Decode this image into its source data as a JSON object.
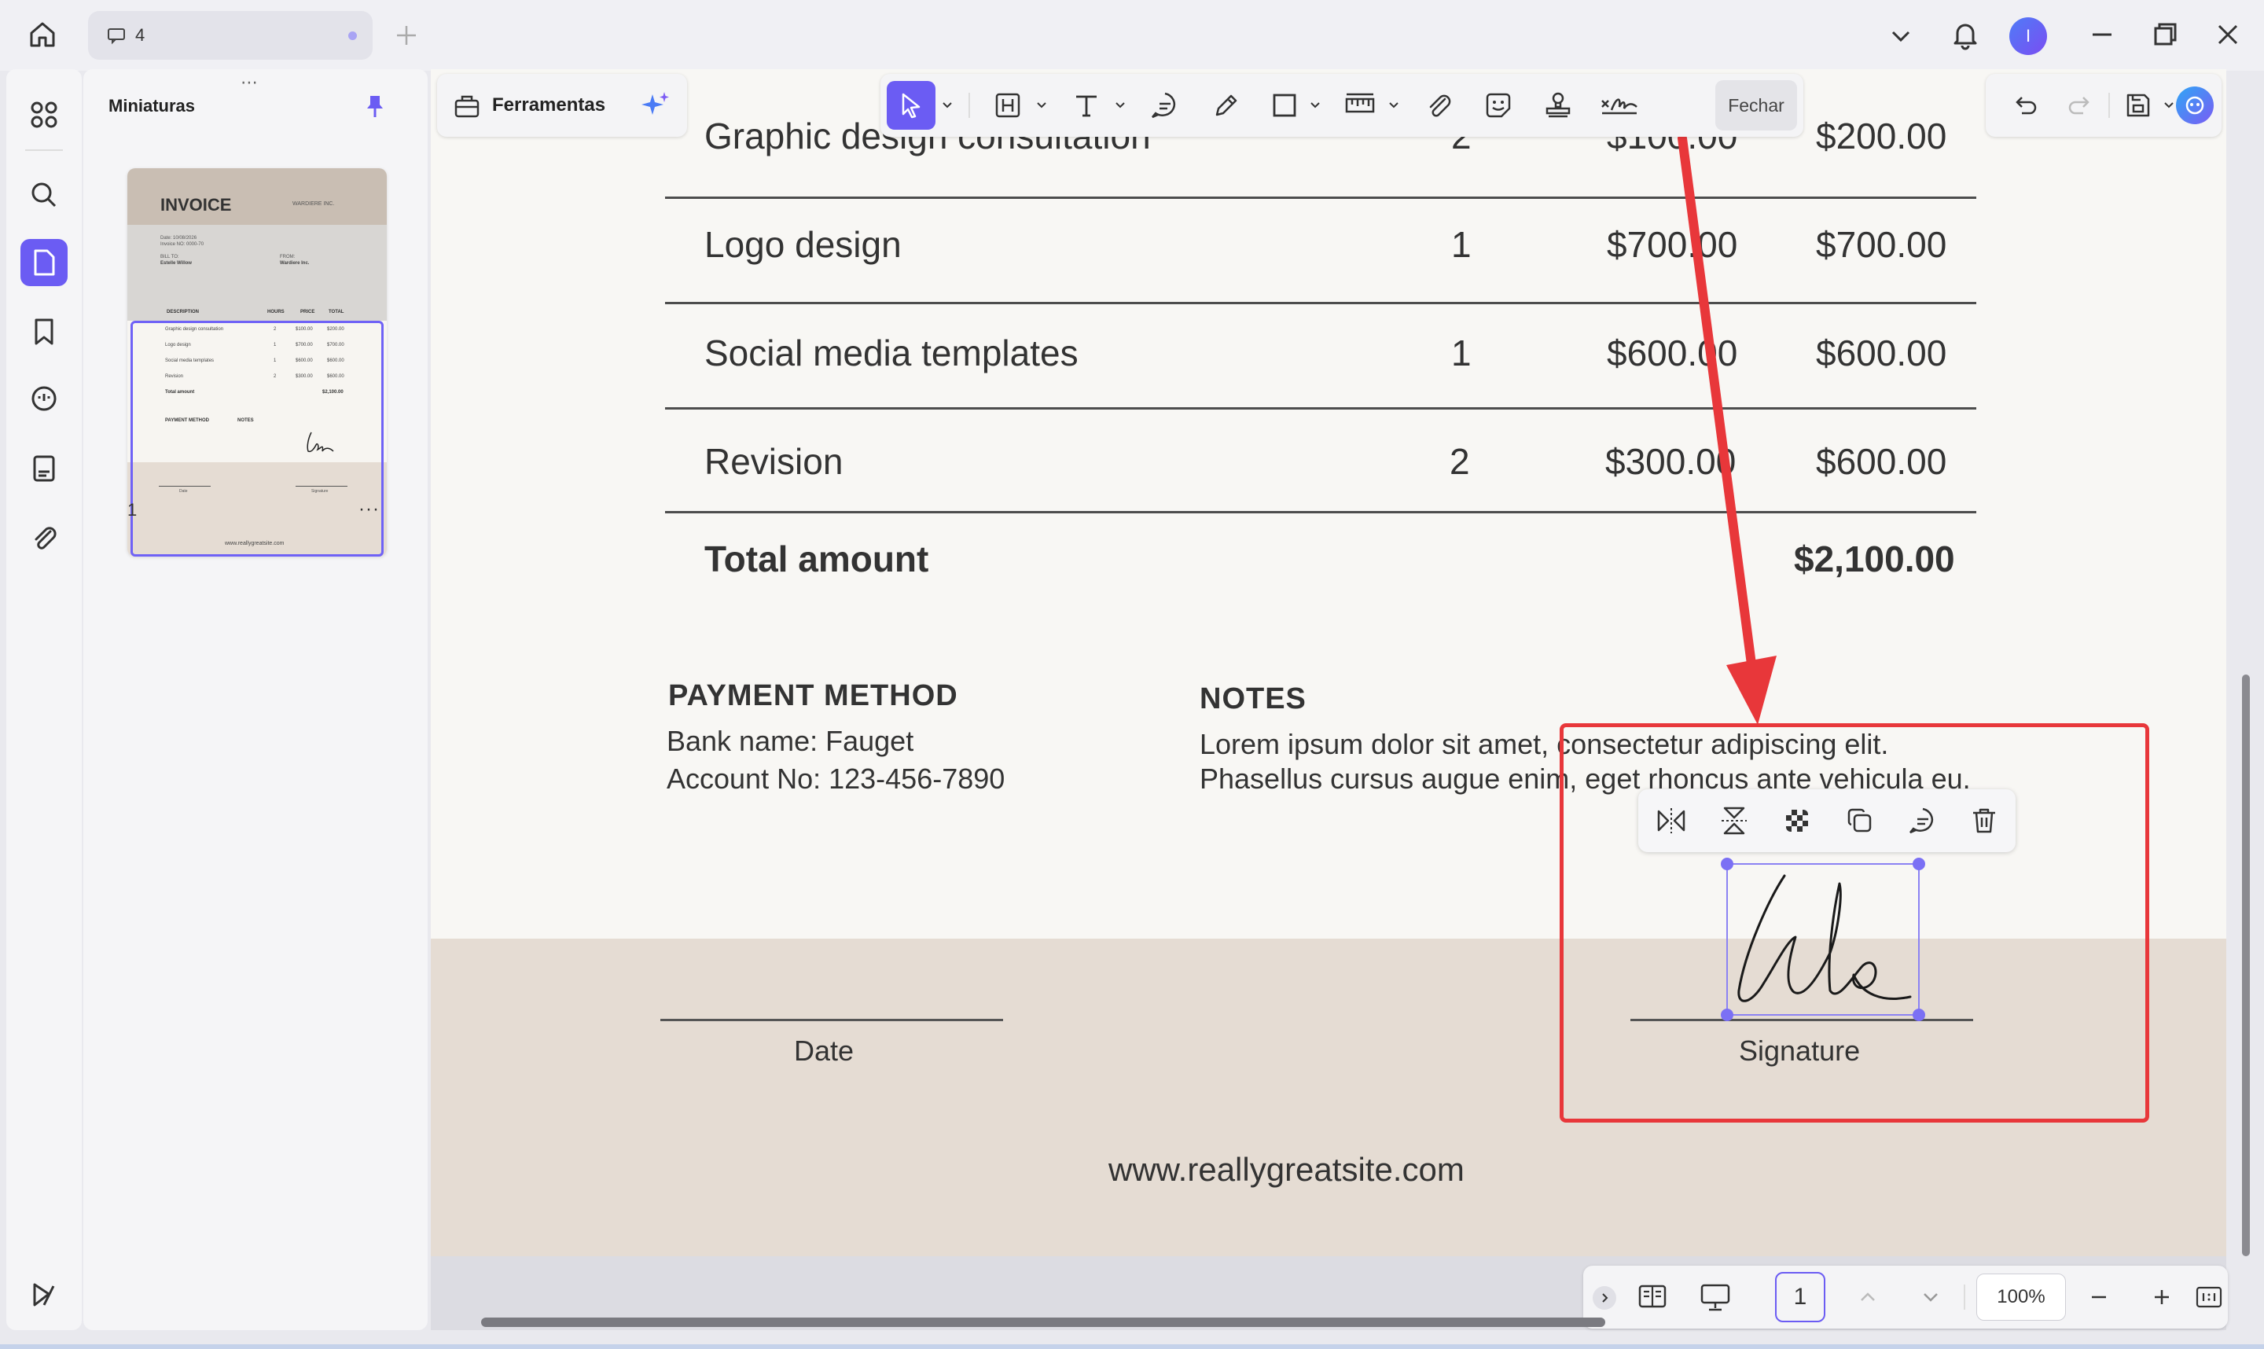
{
  "tab": {
    "label": "4"
  },
  "panel": {
    "title": "Miniaturas",
    "page_number": "1",
    "more": "···"
  },
  "thumbnail": {
    "title": "INVOICE",
    "company": "WARDIERE INC.",
    "date": "Date: 10/08/2026",
    "invoice_no": "Invoice NO: 0000-70",
    "bill_to": "BILL TO:",
    "bill_name": "Estelle Willow",
    "from": "FROM:",
    "from_name": "Wardiere Inc.",
    "columns": [
      "DESCRIPTION",
      "HOURS",
      "PRICE",
      "TOTAL"
    ],
    "rows": [
      [
        "Graphic design consultation",
        "2",
        "$100.00",
        "$200.00"
      ],
      [
        "Logo design",
        "1",
        "$700.00",
        "$700.00"
      ],
      [
        "Social media templates",
        "1",
        "$600.00",
        "$600.00"
      ],
      [
        "Revision",
        "2",
        "$300.00",
        "$600.00"
      ]
    ],
    "total_label": "Total amount",
    "total_value": "$2,100.00",
    "payment": "PAYMENT METHOD",
    "notes": "NOTES",
    "date_label": "Date",
    "signature_label": "Signature",
    "site": "www.reallygreatsite.com"
  },
  "toolbar": {
    "ferramentas": "Ferramentas",
    "fechar": "Fechar"
  },
  "invoice": {
    "rows": [
      {
        "desc": "Graphic design consultation",
        "qty": "2",
        "price": "$100.00",
        "total": "$200.00"
      },
      {
        "desc": "Logo design",
        "qty": "1",
        "price": "$700.00",
        "total": "$700.00"
      },
      {
        "desc": "Social media templates",
        "qty": "1",
        "price": "$600.00",
        "total": "$600.00"
      },
      {
        "desc": "Revision",
        "qty": "2",
        "price": "$300.00",
        "total": "$600.00"
      }
    ],
    "total_label": "Total amount",
    "total_value": "$2,100.00",
    "payment_title": "PAYMENT METHOD",
    "bank": "Bank name: Fauget",
    "account": "Account No: 123-456-7890",
    "notes_title": "NOTES",
    "notes_line1": "Lorem ipsum dolor sit amet, consectetur adipiscing elit.",
    "notes_line2": "Phasellus cursus augue enim, eget rhoncus ante vehicula eu.",
    "date_label": "Date",
    "signature_label": "Signature",
    "website": "www.reallygreatsite.com"
  },
  "bottom": {
    "page": "1",
    "zoom": "100%"
  },
  "user": {
    "avatar_letter": "I"
  },
  "colors": {
    "accent": "#6b5cf3",
    "highlight": "#e8373a",
    "footer": "#e5dcd3",
    "page": "#f8f7f4"
  }
}
